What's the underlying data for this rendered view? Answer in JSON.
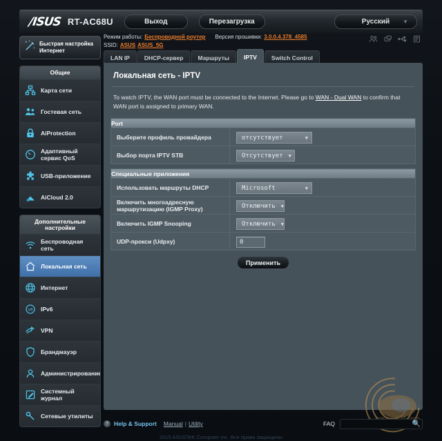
{
  "header": {
    "brand": "/ISUS",
    "model": "RT-AC68U",
    "logout_label": "Выход",
    "reboot_label": "Перезагрузка",
    "language": "Русский",
    "caret": "▼",
    "sys_icons": [
      "clients-icon",
      "network-map-icon",
      "usb-icon",
      "printer-icon"
    ]
  },
  "info": {
    "mode_label": "Режим работы:",
    "mode_value": "Беспроводной роутер",
    "firmware_label": "Версия прошивки:",
    "firmware_value": "3.0.0.4.378_4585",
    "ssid_label": "SSID:",
    "ssid_1": "ASUS",
    "ssid_2": "ASUS_5G"
  },
  "sidebar": {
    "quick_setup": {
      "line1": "Быстрая настройка",
      "line2": "Интернет",
      "icon": "magic-wand-icon"
    },
    "group_general": {
      "title": "Общие",
      "items": [
        {
          "label": "Карта сети",
          "icon": "network-map-icon",
          "active": false
        },
        {
          "label": "Гостевая сеть",
          "icon": "guest-network-icon",
          "active": false
        },
        {
          "label": "AiProtection",
          "icon": "lock-icon",
          "active": false
        },
        {
          "label": "Адаптивный сервис QoS",
          "icon": "gauge-icon",
          "active": false
        },
        {
          "label": "USB-приложение",
          "icon": "usb-app-icon",
          "active": false
        },
        {
          "label": "AiCloud 2.0",
          "icon": "cloud-icon",
          "active": false
        }
      ]
    },
    "group_advanced": {
      "title": "Дополнительные настройки",
      "items": [
        {
          "label": "Беспроводная сеть",
          "icon": "wifi-icon",
          "active": false
        },
        {
          "label": "Локальная сеть",
          "icon": "home-icon",
          "active": true
        },
        {
          "label": "Интернет",
          "icon": "globe-icon",
          "active": false
        },
        {
          "label": "IPv6",
          "icon": "ipv6-icon",
          "active": false
        },
        {
          "label": "VPN",
          "icon": "vpn-icon",
          "active": false
        },
        {
          "label": "Брандмауэр",
          "icon": "shield-icon",
          "active": false
        },
        {
          "label": "Администрирование",
          "icon": "user-icon",
          "active": false
        },
        {
          "label": "Системный журнал",
          "icon": "log-icon",
          "active": false
        },
        {
          "label": "Сетевые утилиты",
          "icon": "wrench-icon",
          "active": false
        }
      ]
    }
  },
  "tabs": [
    {
      "label": "LAN IP",
      "active": false
    },
    {
      "label": "DHCP-сервер",
      "active": false
    },
    {
      "label": "Маршруты",
      "active": false
    },
    {
      "label": "IPTV",
      "active": true
    },
    {
      "label": "Switch Control",
      "active": false
    }
  ],
  "main": {
    "title": "Локальная сеть - IPTV",
    "desc_part1": "To watch IPTV, the WAN port must be connected to the Internet. Please go to ",
    "desc_link": "WAN - Dual WAN",
    "desc_part2": " to confirm that WAN port is assigned to primary WAN.",
    "section_port": {
      "title": "Port",
      "rows": [
        {
          "label": "Выберите профиль провайдера",
          "value": "отсутствует",
          "type": "select",
          "width": "w110"
        },
        {
          "label": "Выбор порта IPTV STB",
          "value": "Отсутствует",
          "type": "select",
          "width": "w85"
        }
      ]
    },
    "section_special": {
      "title": "Специальные приложения",
      "rows": [
        {
          "label": "Использовать маршруты DHCP",
          "value": "Microsoft",
          "type": "select",
          "width": "w110"
        },
        {
          "label": "Включить многоадресную маршрутизацию (IGMP Proxy)",
          "value": "Отключить",
          "type": "select",
          "width": "w70"
        },
        {
          "label": "Включить IGMP Snooping",
          "value": "Отключить",
          "type": "select",
          "width": "w70"
        },
        {
          "label": "UDP-прокси (Udpxy)",
          "value": "0",
          "type": "text",
          "width": ""
        }
      ]
    },
    "apply_label": "Применить",
    "caret": "▼"
  },
  "footer": {
    "help_icon": "?",
    "help_label": "Help & Support",
    "manual_label": "Manual",
    "separator": "|",
    "utility_label": "Utility",
    "faq_label": "FAQ",
    "search_placeholder": "",
    "search_value": "",
    "search_icon": "magnifier-icon",
    "copyright": "2015 ASUSTeK Computer Inc. Все права защищены"
  },
  "watermark": {
    "text": "gecid.com"
  }
}
